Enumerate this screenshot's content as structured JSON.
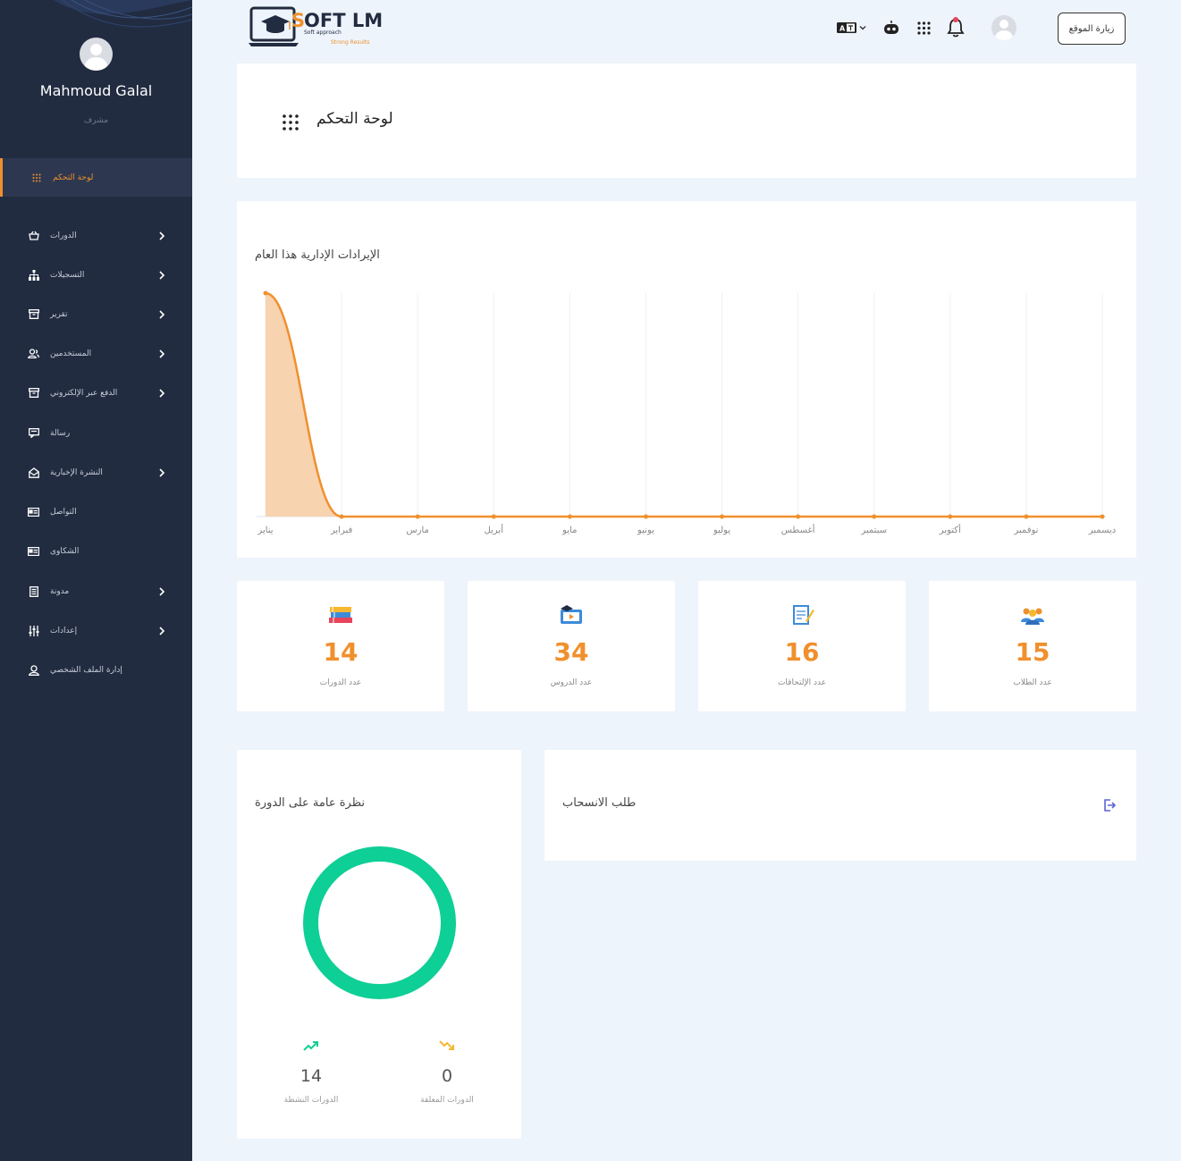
{
  "sidebar": {
    "user_name": "Mahmoud Galal",
    "user_role": "مشرف",
    "items": [
      {
        "label": "لوحة التحكم",
        "icon": "grid-icon",
        "active": true,
        "has_children": false
      },
      {
        "label": "الدورات",
        "icon": "basket-icon",
        "active": false,
        "has_children": true
      },
      {
        "label": "التسجيلات",
        "icon": "sitemap-icon",
        "active": false,
        "has_children": true
      },
      {
        "label": "تقرير",
        "icon": "archive-icon",
        "active": false,
        "has_children": true
      },
      {
        "label": "المستخدمين",
        "icon": "users-icon",
        "active": false,
        "has_children": true
      },
      {
        "label": "الدفع عبر الإلكتروني",
        "icon": "archive-icon",
        "active": false,
        "has_children": true
      },
      {
        "label": "رسالة",
        "icon": "message-icon",
        "active": false,
        "has_children": false
      },
      {
        "label": "النشرة الإخبارية",
        "icon": "envelope-open-icon",
        "active": false,
        "has_children": true
      },
      {
        "label": "التواصل",
        "icon": "contact-card-icon",
        "active": false,
        "has_children": false
      },
      {
        "label": "الشكاوى",
        "icon": "contact-card-icon",
        "active": false,
        "has_children": false
      },
      {
        "label": "مدونة",
        "icon": "document-icon",
        "active": false,
        "has_children": true
      },
      {
        "label": "إعدادات",
        "icon": "sliders-icon",
        "active": false,
        "has_children": true
      },
      {
        "label": "إدارة الملف الشخصي",
        "icon": "user-icon",
        "active": false,
        "has_children": false
      }
    ]
  },
  "topbar": {
    "logo_text": "SOFT LMS",
    "logo_tagline_1": "Soft approach",
    "logo_tagline_2": "Strong Results",
    "language_icon": "translate-icon",
    "visit_site_label": "زيارة الموقع"
  },
  "page": {
    "title": "لوحة التحكم"
  },
  "revenue_chart": {
    "title": "الإيرادات الإدارية هذا العام"
  },
  "chart_data": {
    "type": "area",
    "title": "الإيرادات الإدارية هذا العام",
    "categories": [
      "يناير",
      "فبراير",
      "مارس",
      "أبريل",
      "مايو",
      "يونيو",
      "يوليو",
      "أغسطس",
      "سبتمبر",
      "أكتوبر",
      "نوفمبر",
      "ديسمبر"
    ],
    "values": [
      1,
      0,
      0,
      0,
      0,
      0,
      0,
      0,
      0,
      0,
      0,
      0
    ],
    "ylim": [
      0,
      1
    ],
    "grid": "vertical",
    "line_color": "#f0902d",
    "fill_color": "#f7d3b0"
  },
  "stats": [
    {
      "value": "14",
      "label": "عدد الدورات",
      "icon": "books-icon"
    },
    {
      "value": "34",
      "label": "عدد الدروس",
      "icon": "video-lesson-icon"
    },
    {
      "value": "16",
      "label": "عدد الإلتحاقات",
      "icon": "notepad-icon"
    },
    {
      "value": "15",
      "label": "عدد الطلاب",
      "icon": "students-icon"
    }
  ],
  "overview": {
    "title": "نظرة عامة على الدورة",
    "ring_color": "#0ecf96",
    "active_value": "14",
    "active_label": "الدورات النشطة",
    "pending_value": "0",
    "pending_label": "الدورات المعلقة"
  },
  "withdrawal": {
    "title": "طلب الانسحاب",
    "icon": "logout-icon"
  },
  "colors": {
    "accent": "#f0902d",
    "sidebar_bg": "#222c41",
    "page_bg": "#eef4fb"
  }
}
